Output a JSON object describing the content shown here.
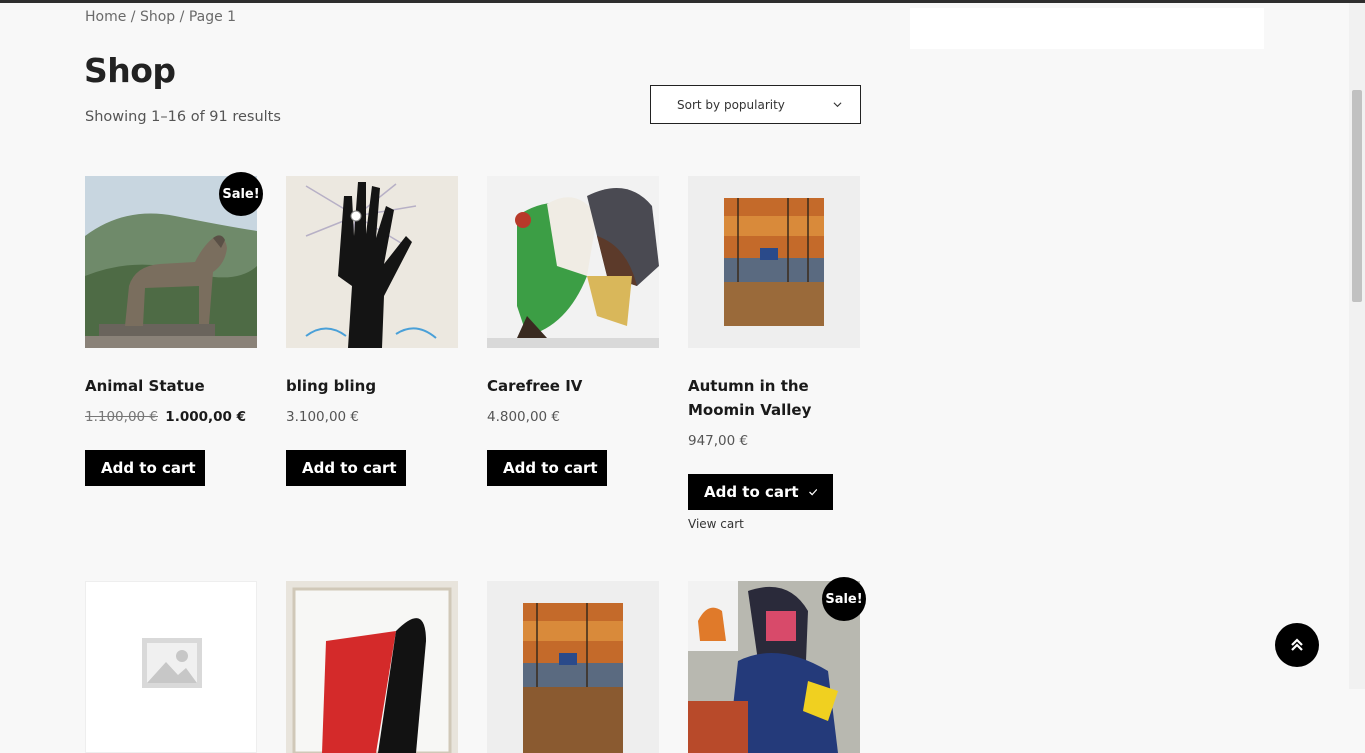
{
  "breadcrumb": {
    "home": "Home",
    "sep1": " / ",
    "shop": "Shop",
    "sep2": " / ",
    "page": "Page 1"
  },
  "title": "Shop",
  "result_count": "Showing 1–16 of 91 results",
  "sort": {
    "selected": "Sort by popularity"
  },
  "products": [
    {
      "title": "Animal Statue",
      "regular_price": "1.100,00 €",
      "sale_price": "1.000,00 €",
      "badge": "Sale!",
      "cart_label": "Add to cart"
    },
    {
      "title": "bling bling",
      "price": "3.100,00 €",
      "cart_label": "Add to cart"
    },
    {
      "title": "Carefree IV",
      "price": "4.800,00 €",
      "cart_label": "Add to cart"
    },
    {
      "title_line1": "Autumn in the",
      "title_line2": "Moomin Valley",
      "price": "947,00 €",
      "cart_label": "Add to cart",
      "view_cart": "View cart"
    },
    {},
    {},
    {},
    {
      "badge": "Sale!"
    }
  ],
  "colors": {
    "background": "#f8f8f8",
    "button": "#000000",
    "button_text": "#ffffff"
  },
  "icons": [
    "chevron-down-icon",
    "checkmark-icon",
    "placeholder-image-icon",
    "back-to-top-icon"
  ]
}
